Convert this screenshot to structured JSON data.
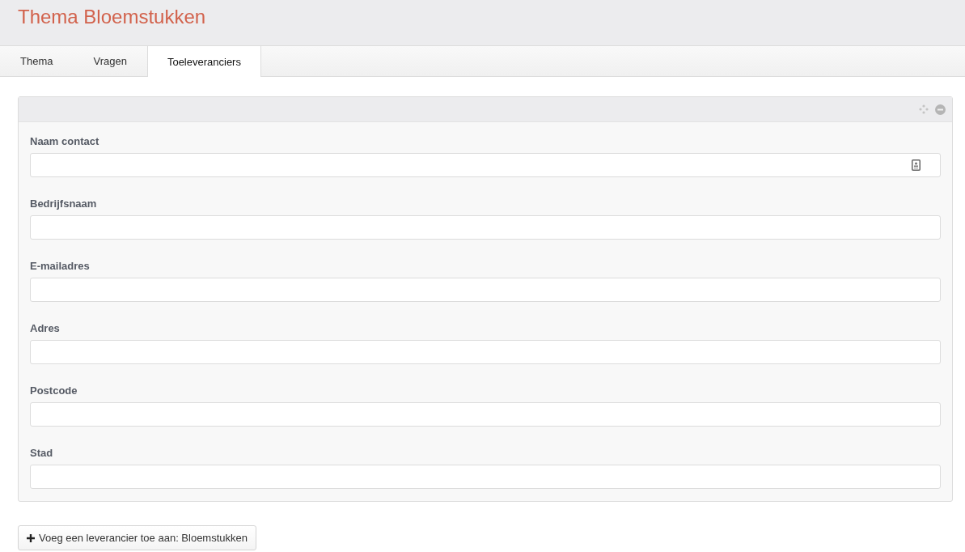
{
  "header": {
    "title": "Thema Bloemstukken"
  },
  "tabs": [
    {
      "label": "Thema",
      "selected": false
    },
    {
      "label": "Vragen",
      "selected": false
    },
    {
      "label": "Toeleveranciers",
      "selected": true
    }
  ],
  "panel": {
    "fields": [
      {
        "label": "Naam contact",
        "kind": "contact"
      },
      {
        "label": "Bedrijfsnaam",
        "kind": "text"
      },
      {
        "label": "E-mailadres",
        "kind": "text"
      },
      {
        "label": "Adres",
        "kind": "text"
      },
      {
        "label": "Postcode",
        "kind": "text"
      },
      {
        "label": "Stad",
        "kind": "text"
      }
    ]
  },
  "add_button": {
    "label": "Voeg een leverancier toe aan: Bloemstukken"
  }
}
